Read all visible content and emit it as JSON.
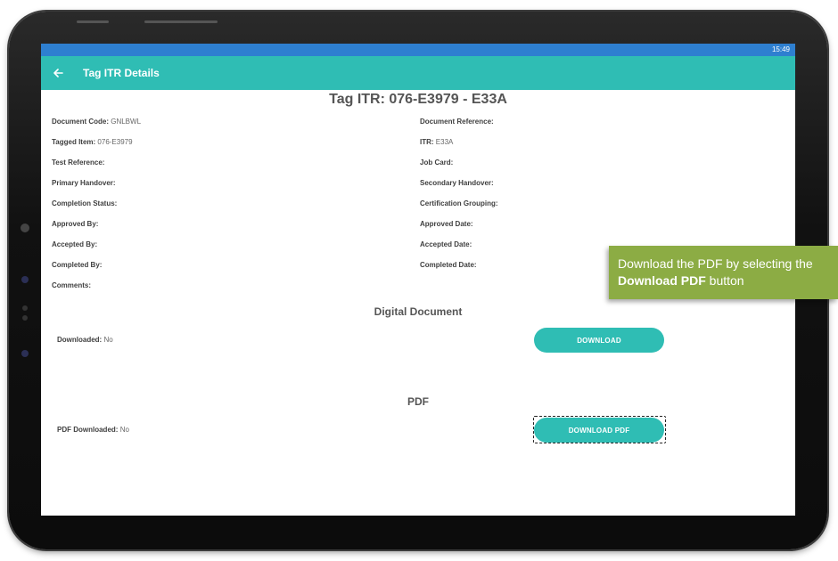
{
  "status_bar": {
    "time": "15:49"
  },
  "app_bar": {
    "back_icon": "arrow-left-icon",
    "title": "Tag ITR Details"
  },
  "page": {
    "heading": "Tag ITR: 076-E3979 - E33A"
  },
  "fields_left": [
    {
      "label": "Document Code:",
      "value": "GNLBWL"
    },
    {
      "label": "Tagged Item:",
      "value": "076-E3979"
    },
    {
      "label": "Test Reference:",
      "value": ""
    },
    {
      "label": "Primary Handover:",
      "value": ""
    },
    {
      "label": "Completion Status:",
      "value": ""
    },
    {
      "label": "Approved By:",
      "value": ""
    },
    {
      "label": "Accepted By:",
      "value": ""
    },
    {
      "label": "Completed By:",
      "value": ""
    },
    {
      "label": "Comments:",
      "value": ""
    }
  ],
  "fields_right": [
    {
      "label": "Document Reference:",
      "value": ""
    },
    {
      "label": "ITR:",
      "value": "E33A"
    },
    {
      "label": "Job Card:",
      "value": ""
    },
    {
      "label": "Secondary Handover:",
      "value": ""
    },
    {
      "label": "Certification Grouping:",
      "value": ""
    },
    {
      "label": "Approved Date:",
      "value": ""
    },
    {
      "label": "Accepted Date:",
      "value": ""
    },
    {
      "label": "Completed Date:",
      "value": ""
    }
  ],
  "digital_document": {
    "title": "Digital Document",
    "downloaded_label": "Downloaded:",
    "downloaded_value": "No",
    "button_label": "DOWNLOAD"
  },
  "pdf": {
    "title": "PDF",
    "downloaded_label": "PDF Downloaded:",
    "downloaded_value": "No",
    "button_label": "DOWNLOAD PDF"
  },
  "callout": {
    "text_before": "Download the PDF by selecting the",
    "bold_text": "Download PDF",
    "text_after": "button"
  },
  "colors": {
    "app_bar": "#2fbdb4",
    "status_bar": "#2e7fd0",
    "button": "#2fbdb4",
    "callout": "#8cac44"
  }
}
